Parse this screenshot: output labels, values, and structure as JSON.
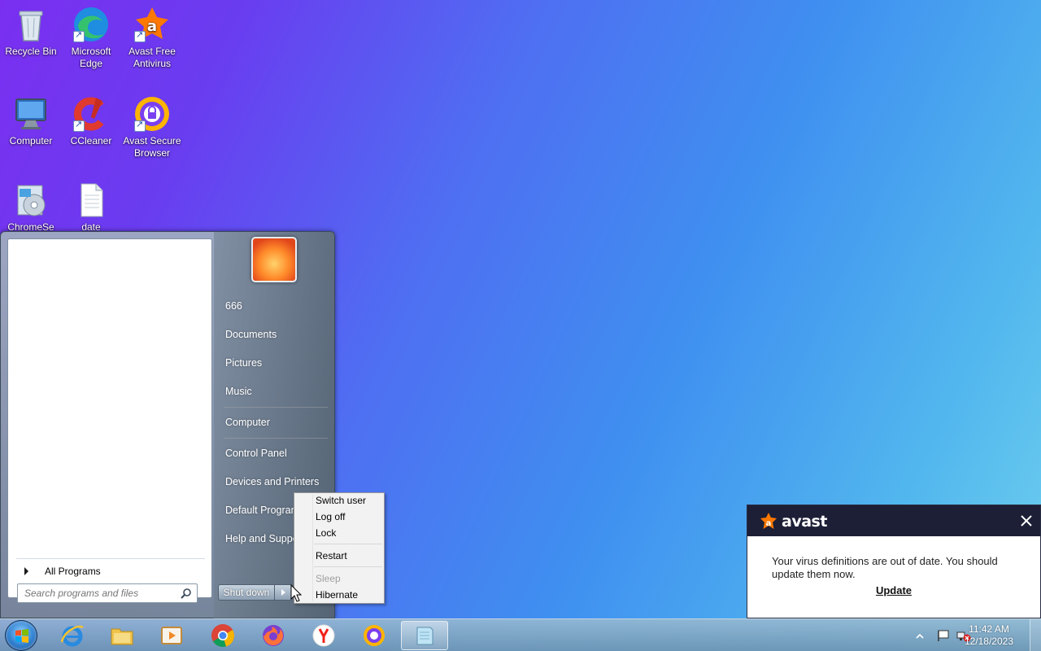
{
  "desktop": {
    "icons": [
      {
        "label": "Recycle Bin"
      },
      {
        "label": "Microsoft\nEdge"
      },
      {
        "label": "Avast Free\nAntivirus"
      },
      {
        "label": "Computer"
      },
      {
        "label": "CCleaner"
      },
      {
        "label": "Avast Secure\nBrowser"
      },
      {
        "label": "ChromeSe"
      },
      {
        "label": "date"
      }
    ]
  },
  "start_menu": {
    "all_programs": "All Programs",
    "search_placeholder": "Search programs and files",
    "right_items": [
      "666",
      "Documents",
      "Pictures",
      "Music",
      "Computer",
      "Control Panel",
      "Devices and Printers",
      "Default Programs",
      "Help and Support"
    ],
    "shutdown_label": "Shut down"
  },
  "shutdown_flyout": {
    "items": [
      "Switch user",
      "Log off",
      "Lock",
      "Restart",
      "Sleep",
      "Hibernate"
    ]
  },
  "avast_notification": {
    "brand": "avast",
    "message": "Your virus definitions are out of date. You should update them now.",
    "action": "Update"
  },
  "taskbar": {
    "pinned": [
      "internet-explorer-icon",
      "file-explorer-icon",
      "media-player-icon",
      "chrome-icon",
      "firefox-icon",
      "yandex-icon",
      "avast-browser-icon",
      "notepad-icon"
    ],
    "clock_time": "11:42 AM",
    "clock_date": "12/18/2023"
  }
}
